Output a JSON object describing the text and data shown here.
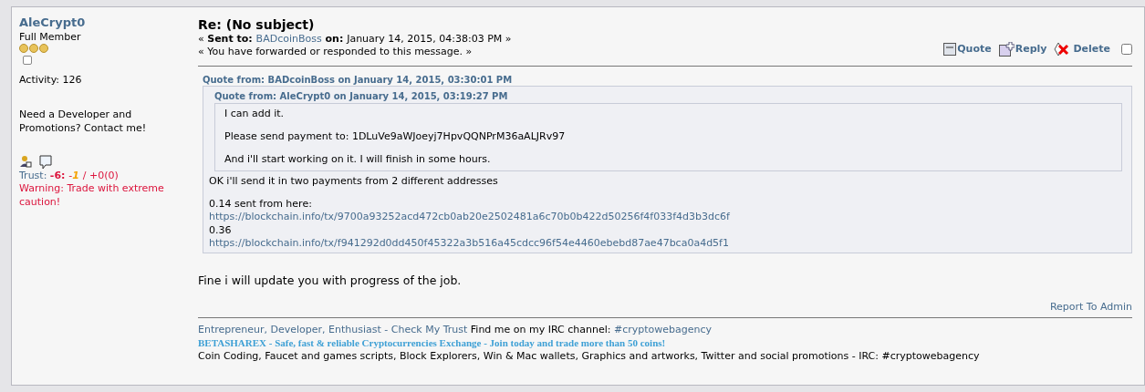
{
  "poster": {
    "name": "AleCrypt0",
    "rank": "Full Member",
    "stars": 3,
    "activity": "Activity: 126",
    "personal_text": "Need a Developer and Promotions? Contact me!",
    "trust": {
      "label": "Trust:",
      "score": "-6",
      "separator": ":",
      "recent": "-1",
      "slash": "/",
      "positive": "+0(0)"
    },
    "warning": "Warning: Trade with extreme caution!"
  },
  "message": {
    "subject": "Re: (No subject)",
    "sent": {
      "open": "«",
      "label": "Sent to:",
      "recipient": "BADcoinBoss",
      "on_label": "on:",
      "date": "January 14, 2015, 04:38:03 PM »"
    },
    "notice": "« You have forwarded or responded to this message. »",
    "actions": [
      {
        "label": "Quote",
        "kind": "quote"
      },
      {
        "label": "Reply",
        "kind": "reply"
      },
      {
        "label": "Delete",
        "kind": "delete"
      }
    ],
    "select_checked": false,
    "quote": {
      "header": "Quote from: BADcoinBoss on January 14, 2015, 03:30:01 PM",
      "inner": {
        "header": "Quote from: AleCrypt0 on January 14, 2015, 03:19:27 PM",
        "paragraphs": [
          [
            {
              "kind": "text",
              "text": "I can add it."
            }
          ],
          [
            {
              "kind": "text",
              "text": "Please send payment to: 1DLuVe9aWJoeyj7HpvQQNPrM36aALJRv97"
            }
          ],
          [
            {
              "kind": "text",
              "text": "And i'll  start working on it. I will finish in some hours."
            }
          ]
        ]
      },
      "paragraphs": [
        [
          {
            "kind": "text",
            "text": "OK i'll send it in two payments from 2 different addresses"
          }
        ],
        [
          {
            "kind": "text",
            "text": "0.14 sent from here:"
          },
          {
            "kind": "link",
            "text": "https://blockchain.info/tx/9700a93252acd472cb0ab20e2502481a6c70b0b422d50256f4f033f4d3b3dc6f"
          },
          {
            "kind": "text",
            "text": "0.36"
          },
          {
            "kind": "link",
            "text": "https://blockchain.info/tx/f941292d0dd450f45322a3b516a45cdcc96f54e4460ebebd87ae47bca0a4d5f1"
          }
        ]
      ]
    },
    "body": "Fine i will update you with progress of the job.",
    "report": "Report To Admin",
    "signature": [
      [
        {
          "kind": "link",
          "text": "Entrepreneur, Developer, Enthusiast - Check My Trust"
        },
        {
          "kind": "text",
          "text": "Find me on my IRC channel:"
        },
        {
          "kind": "link",
          "text": "#cryptowebagency"
        }
      ],
      [
        {
          "kind": "promo",
          "text": "BETASHAREX - Safe, fast & reliable Cryptocurrencies Exchange - Join today and trade more than 50 coins!"
        }
      ],
      [
        {
          "kind": "text",
          "text": "Coin Coding, Faucet and games scripts, Block Explorers, Win & Mac wallets, Graphics and artworks, Twitter and social promotions - IRC: #cryptowebagency"
        }
      ]
    ]
  }
}
